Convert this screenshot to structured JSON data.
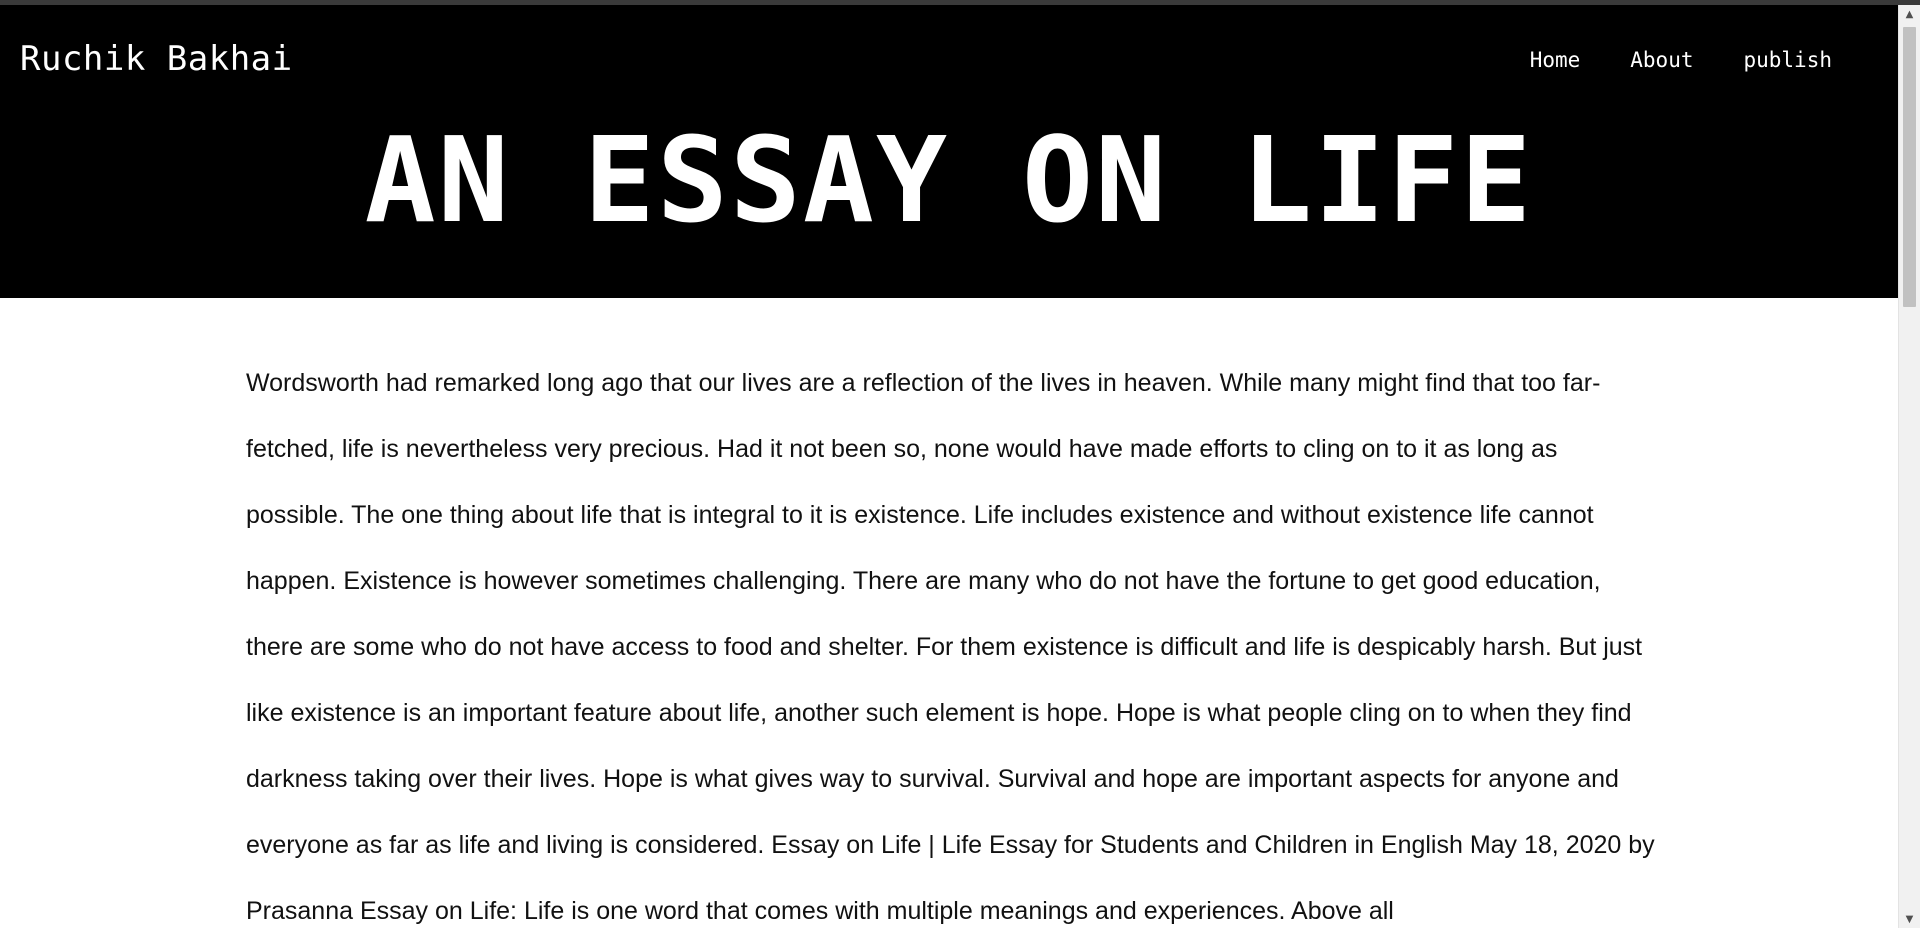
{
  "header": {
    "brand": "Ruchik Bakhai",
    "nav": [
      {
        "label": "Home"
      },
      {
        "label": "About"
      },
      {
        "label": "publish"
      }
    ],
    "title": "AN ESSAY ON LIFE"
  },
  "article": {
    "body": "Wordsworth had remarked long ago that our lives are a reflection of the lives in heaven. While many might find that too far-fetched, life is nevertheless very precious. Had it not been so, none would have made efforts to cling on to it as long as possible. The one thing about life that is integral to it is existence. Life includes existence and without existence life cannot happen. Existence is however sometimes challenging. There are many who do not have the fortune to get good education, there are some who do not have access to food and shelter. For them existence is difficult and life is despicably harsh. But just like existence is an important feature about life, another such element is hope. Hope is what people cling on to when they find darkness taking over their lives. Hope is what gives way to survival. Survival and hope are important aspects for anyone and everyone as far as life and living is considered. Essay on Life | Life Essay for Students and Children in English May 18, 2020 by Prasanna Essay on Life: Life is one word that comes with multiple meanings and experiences. Above all"
  },
  "scrollbar": {
    "up_icon": "▲",
    "down_icon": "▼"
  },
  "colors": {
    "header_bg": "#000000",
    "header_text": "#ffffff",
    "body_text": "#111111",
    "page_bg": "#ffffff"
  }
}
